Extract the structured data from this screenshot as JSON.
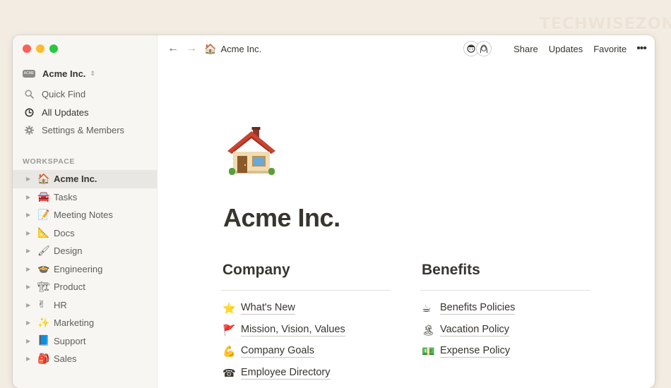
{
  "watermark": "TECHWISEZONE",
  "sidebar": {
    "workspace": {
      "logo_text": "ACME",
      "name": "Acme Inc.",
      "chevron": "⇕"
    },
    "nav": [
      {
        "label": "Quick Find",
        "icon": "search-icon"
      },
      {
        "label": "All Updates",
        "icon": "clock-icon"
      },
      {
        "label": "Settings & Members",
        "icon": "gear-icon"
      }
    ],
    "section_label": "WORKSPACE",
    "pages": [
      {
        "emoji": "🏠",
        "label": "Acme Inc."
      },
      {
        "emoji": "🚘",
        "label": "Tasks"
      },
      {
        "emoji": "📝",
        "label": "Meeting Notes"
      },
      {
        "emoji": "📐",
        "label": "Docs"
      },
      {
        "emoji": "🖌",
        "label": "Design"
      },
      {
        "emoji": "🍲",
        "label": "Engineering"
      },
      {
        "emoji": "🏗",
        "label": "Product"
      },
      {
        "emoji": "✌",
        "label": "HR"
      },
      {
        "emoji": "✨",
        "label": "Marketing"
      },
      {
        "emoji": "📘",
        "label": "Support"
      },
      {
        "emoji": "🎒",
        "label": "Sales"
      }
    ]
  },
  "topbar": {
    "breadcrumb": {
      "emoji": "🏠",
      "label": "Acme Inc."
    },
    "share_label": "Share",
    "updates_label": "Updates",
    "favorite_label": "Favorite",
    "more_label": "•••"
  },
  "page": {
    "title": "Acme Inc.",
    "columns": [
      {
        "heading": "Company",
        "links": [
          {
            "emoji": "⭐",
            "label": "What's New"
          },
          {
            "emoji": "🚩",
            "label": "Mission, Vision, Values"
          },
          {
            "emoji": "💪",
            "label": "Company Goals"
          },
          {
            "emoji": "☎",
            "label": "Employee Directory"
          }
        ]
      },
      {
        "heading": "Benefits",
        "links": [
          {
            "emoji": "☕",
            "label": "Benefits Policies"
          },
          {
            "emoji": "🏝",
            "label": "Vacation Policy"
          },
          {
            "emoji": "💵",
            "label": "Expense Policy"
          }
        ]
      }
    ]
  },
  "colors": {
    "sidebar_bg": "#f7f6f3",
    "selected_bg": "#e8e7e4",
    "text": "#37352f",
    "outer_bg": "#f3ece3"
  }
}
